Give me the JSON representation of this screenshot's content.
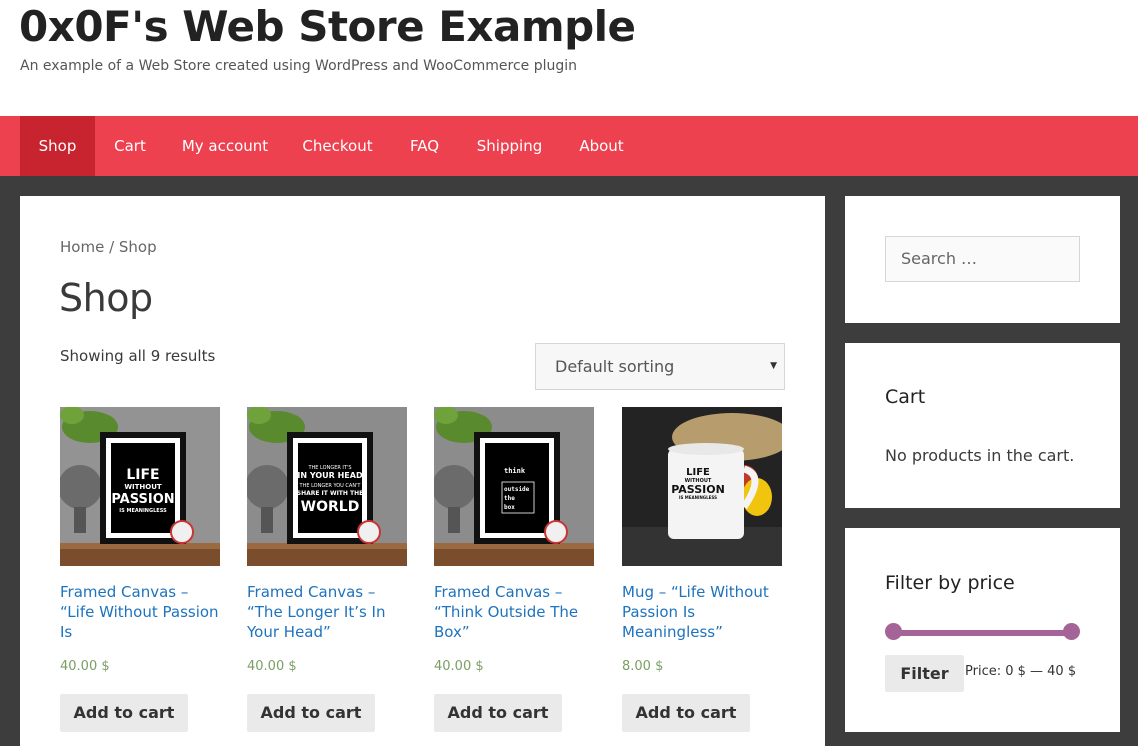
{
  "site": {
    "title": "0x0F's Web Store Example",
    "tagline": "An example of a Web Store created using WordPress and WooCommerce plugin"
  },
  "nav": {
    "items": [
      {
        "label": "Shop",
        "active": true
      },
      {
        "label": "Cart"
      },
      {
        "label": "My account"
      },
      {
        "label": "Checkout"
      },
      {
        "label": "FAQ"
      },
      {
        "label": "Shipping"
      },
      {
        "label": "About"
      }
    ]
  },
  "main": {
    "breadcrumb": "Home / Shop",
    "title": "Shop",
    "result_count": "Showing all 9 results",
    "sort": {
      "selected": "Default sorting"
    },
    "products": [
      {
        "title": "Framed Canvas – “Life Without Passion Is",
        "price": "40.00 $",
        "button": "Add to cart",
        "image_text": [
          "LIFE",
          "WITHOUT",
          "PASSION",
          "IS MEANINGLESS"
        ]
      },
      {
        "title": "Framed Canvas – “The Longer It’s In Your Head”",
        "price": "40.00 $",
        "button": "Add to cart",
        "image_text": [
          "THE LONGER IT'S",
          "IN YOUR HEAD",
          "THE LONGER YOU CAN'T",
          "SHARE IT WITH THE",
          "WORLD"
        ]
      },
      {
        "title": "Framed Canvas – “Think Outside The Box”",
        "price": "40.00 $",
        "button": "Add to cart",
        "image_text": [
          "think",
          "outside",
          "the",
          "box"
        ]
      },
      {
        "title": "Mug – “Life Without Passion Is Meaningless”",
        "price": "8.00 $",
        "button": "Add to cart",
        "image_text": [
          "LIFE",
          "WITHOUT",
          "PASSION",
          "IS MEANINGLESS"
        ]
      }
    ]
  },
  "sidebar": {
    "search": {
      "placeholder": "Search …"
    },
    "cart": {
      "title": "Cart",
      "empty_text": "No products in the cart."
    },
    "price_filter": {
      "title": "Filter by price",
      "button": "Filter",
      "price_text": "Price: 0 $ — 40 $",
      "min": 0,
      "max": 40
    }
  },
  "colors": {
    "nav_bg": "#ee4150",
    "nav_active": "#c8242f",
    "link": "#1e73be",
    "price": "#7a9f64",
    "slider": "#a46497"
  }
}
